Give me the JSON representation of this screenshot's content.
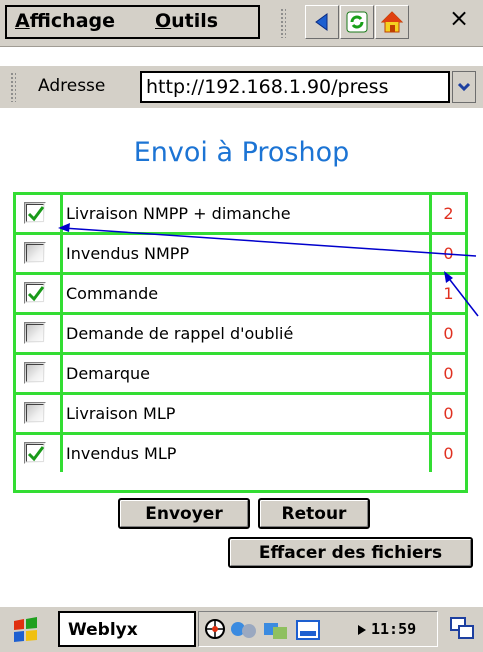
{
  "menubar": {
    "view_label": "Affichage",
    "view_accel": "A",
    "view_rest": "ffichage",
    "tools_label": "Outils",
    "tools_accel": "O",
    "tools_rest": "utils",
    "buttons": [
      "back-arrow-icon",
      "refresh-icon",
      "home-icon"
    ],
    "close_glyph": "×"
  },
  "address": {
    "label": "Adresse",
    "value": "http://192.168.1.90/press"
  },
  "page": {
    "title": "Envoi à Proshop"
  },
  "items": [
    {
      "label": "Livraison NMPP + dimanche",
      "count": "2",
      "checked": true
    },
    {
      "label": "Invendus NMPP",
      "count": "0",
      "checked": false
    },
    {
      "label": "Commande",
      "count": "1",
      "checked": true
    },
    {
      "label": "Demande de rappel d'oublié",
      "count": "0",
      "checked": false
    },
    {
      "label": "Demarque",
      "count": "0",
      "checked": false
    },
    {
      "label": "Livraison MLP",
      "count": "0",
      "checked": false
    },
    {
      "label": "Invendus MLP",
      "count": "0",
      "checked": true
    }
  ],
  "actions": {
    "send": "Envoyer",
    "back": "Retour",
    "clear": "Effacer des fichiers"
  },
  "taskbar": {
    "app": "Weblyx",
    "clock": "11:59"
  },
  "colors": {
    "accent": "#1c74d4",
    "grid": "#33dd33",
    "count": "#e03020",
    "annotation_arrow": "#0000cc"
  }
}
